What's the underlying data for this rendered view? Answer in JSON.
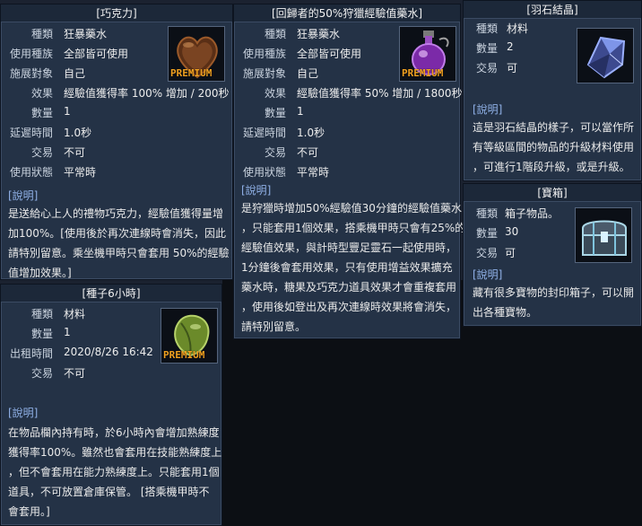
{
  "chocolate": {
    "title": "[巧克力]",
    "rows": [
      {
        "label": "種類",
        "value": "狂暴藥水"
      },
      {
        "label": "使用種族",
        "value": "全部皆可使用"
      },
      {
        "label": "施展對象",
        "value": "自己"
      },
      {
        "label": "效果",
        "value": "經驗值獲得率 100% 增加 / 200秒"
      },
      {
        "label": "數量",
        "value": "1"
      },
      {
        "label": "延遲時間",
        "value": "1.0秒"
      },
      {
        "label": "交易",
        "value": "不可"
      },
      {
        "label": "使用狀態",
        "value": "平常時"
      }
    ],
    "desc_head": "[說明]",
    "desc_lines": [
      "是送給心上人的禮物巧克力，經驗值獲得量增",
      "加100%。[使用後於再次連線時會消失，因此",
      "請特別留意。乘坐機甲時只會套用 50%的經驗",
      "值增加效果。]"
    ],
    "icon": "chocolate-icon",
    "premium": "PREMIUM"
  },
  "potion": {
    "title": "[回歸者的50%狩獵經驗值藥水]",
    "rows": [
      {
        "label": "種類",
        "value": "狂暴藥水"
      },
      {
        "label": "使用種族",
        "value": "全部皆可使用"
      },
      {
        "label": "施展對象",
        "value": "自己"
      },
      {
        "label": "效果",
        "value": "經驗值獲得率 50% 增加 / 1800秒"
      },
      {
        "label": "數量",
        "value": "1"
      },
      {
        "label": "延遲時間",
        "value": "1.0秒"
      },
      {
        "label": "交易",
        "value": "不可"
      },
      {
        "label": "使用狀態",
        "value": "平常時"
      }
    ],
    "desc_head": "[說明]",
    "desc_lines": [
      "是狩獵時增加50%經驗值30分鐘的經驗值藥水",
      "，只能套用1個效果，搭乘機甲時只會有25%的",
      "經驗值效果，與計時型豐足靈石一起使用時，",
      "1分鐘後會套用效果，只有使用增益效果擴充",
      "藥水時，糖果及巧克力道具效果才會重複套用",
      "，使用後如登出及再次連線時效果將會消失，",
      "請特別留意。"
    ],
    "icon": "potion-icon",
    "premium": "PREMIUM"
  },
  "feather": {
    "title": "[羽石結晶]",
    "rows": [
      {
        "label": "種類",
        "value": "材料"
      },
      {
        "label": "數量",
        "value": "2"
      },
      {
        "label": "交易",
        "value": "可"
      }
    ],
    "desc_head": "[說明]",
    "desc_lines": [
      "這是羽石結晶的樣子，可以當作所",
      "有等級區間的物品的升級材料使用",
      "，可進行1階段升級，或是升級。"
    ],
    "icon": "crystal-icon"
  },
  "chest": {
    "title": "[寶箱]",
    "rows": [
      {
        "label": "種類",
        "value": "箱子物品。"
      },
      {
        "label": "數量",
        "value": "30"
      },
      {
        "label": "交易",
        "value": "可"
      }
    ],
    "desc_head": "[說明]",
    "desc_lines": [
      "藏有很多寶物的封印箱子，可以開",
      "出各種寶物。"
    ],
    "icon": "treasure-chest-icon"
  },
  "seed": {
    "title": "[種子6小時]",
    "rows": [
      {
        "label": "種類",
        "value": "材料"
      },
      {
        "label": "數量",
        "value": "1"
      },
      {
        "label": "出租時間",
        "value": "2020/8/26 16:42"
      },
      {
        "label": "交易",
        "value": "不可"
      }
    ],
    "desc_head": "[說明]",
    "desc_lines": [
      "在物品欄內持有時，於6小時內會增加熟練度",
      "獲得率100%。雖然也會套用在技能熟練度上",
      "，但不會套用在能力熟練度上。只能套用1個",
      "道具，不可放置倉庫保管。 [搭乘機甲時不",
      "會套用。]"
    ],
    "icon": "seed-icon",
    "premium": "PREMIUM"
  }
}
